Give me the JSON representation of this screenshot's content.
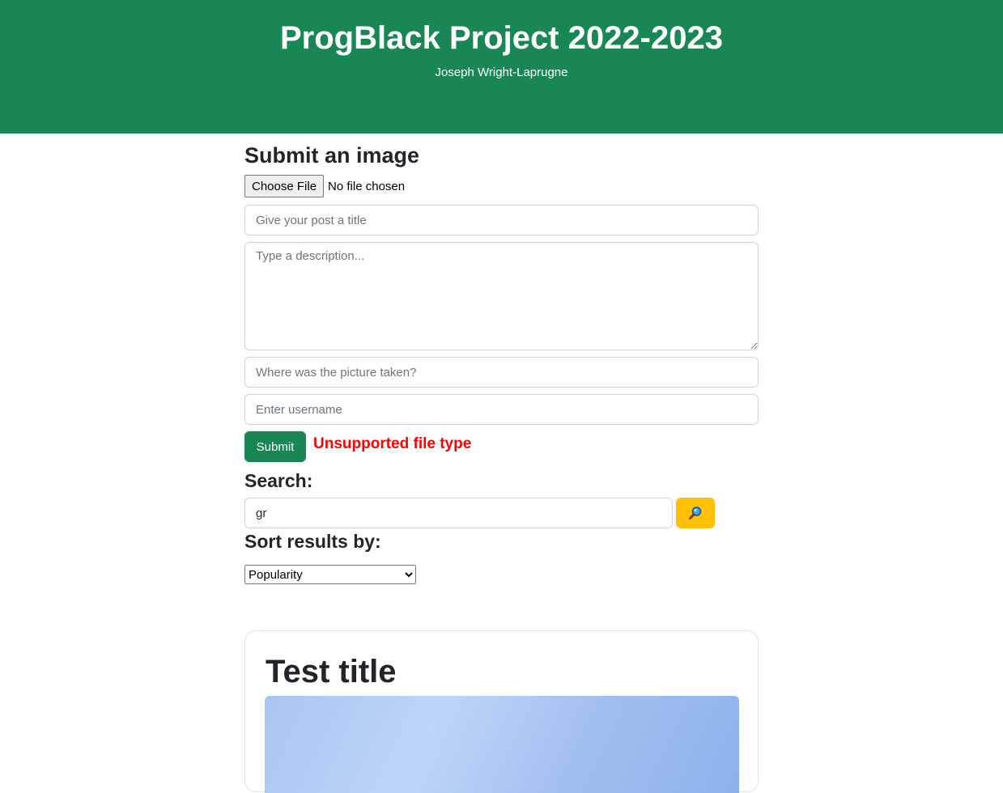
{
  "header": {
    "title": "ProgBlack Project 2022-2023",
    "author": "Joseph Wright-Laprugne"
  },
  "upload_form": {
    "heading": "Submit an image",
    "file_button_label": "Choose File",
    "file_status": "No file chosen",
    "title_placeholder": "Give your post a title",
    "description_placeholder": "Type a description...",
    "location_placeholder": "Where was the picture taken?",
    "username_placeholder": "Enter username",
    "submit_label": "Submit",
    "error_message": "Unsupported file type"
  },
  "search": {
    "heading": "Search:",
    "value": "gr",
    "button_icon": "magnifying-glass-icon"
  },
  "sort": {
    "heading": "Sort results by:",
    "selected": "Popularity"
  },
  "posts": [
    {
      "title": "Test title"
    }
  ],
  "colors": {
    "header_bg": "#198754",
    "submit_bg": "#198754",
    "search_button_bg": "#ffc107",
    "error": "#ff0000"
  }
}
